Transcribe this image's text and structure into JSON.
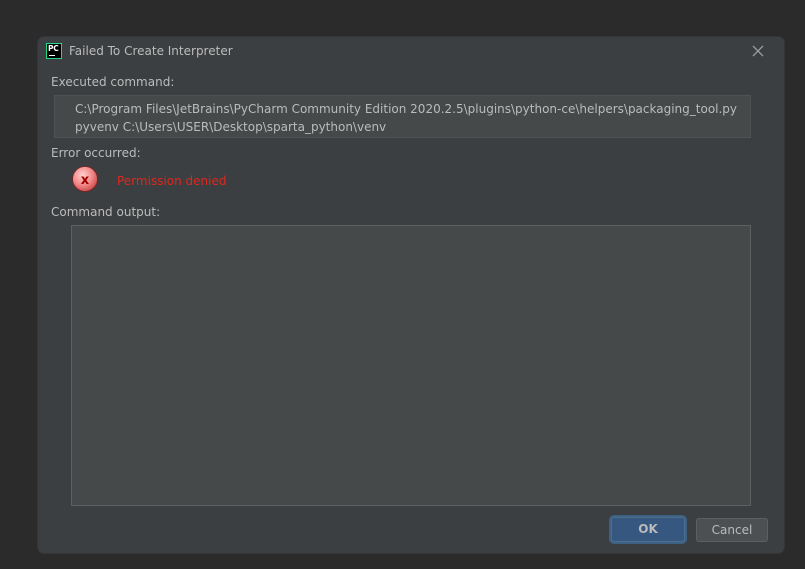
{
  "dialog": {
    "title": "Failed To Create Interpreter",
    "icon": "pycharm-icon",
    "icon_text": "PC"
  },
  "executed": {
    "label": "Executed command:",
    "line1": "C:\\Program Files\\JetBrains\\PyCharm Community Edition 2020.2.5\\plugins\\python-ce\\helpers\\packaging_tool.py",
    "line2": "pyvenv C:\\Users\\USER\\Desktop\\sparta_python\\venv"
  },
  "error": {
    "label": "Error occurred:",
    "icon": "error-icon",
    "message": "Permission denied",
    "color": "#e0261e"
  },
  "output": {
    "label": "Command output:",
    "text": ""
  },
  "buttons": {
    "ok": "OK",
    "cancel": "Cancel"
  },
  "colors": {
    "dialog_bg": "#3c3f41",
    "text": "#bbbbbb",
    "accent": "#365880"
  }
}
